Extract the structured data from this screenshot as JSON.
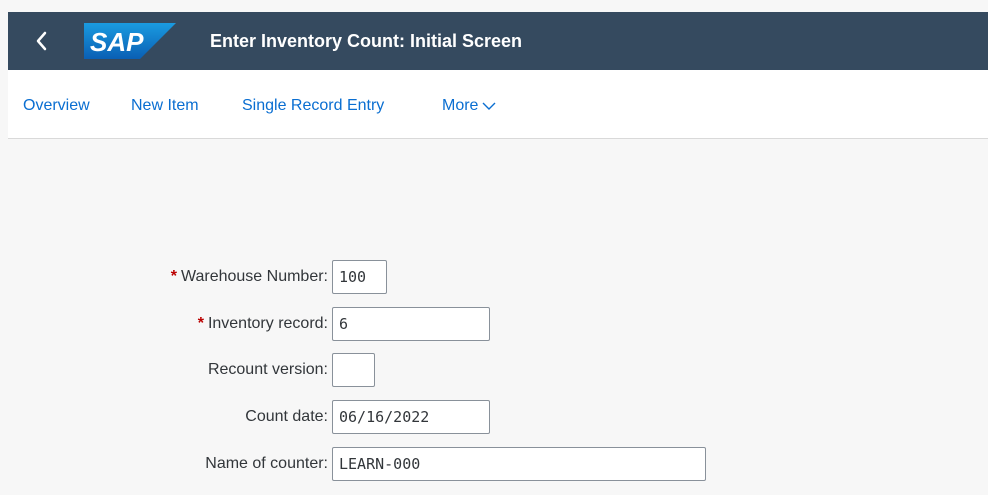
{
  "header": {
    "title": "Enter Inventory Count: Initial Screen",
    "logo_text": "SAP",
    "back_icon": "chevron-left-icon"
  },
  "colors": {
    "shell": "#354a5f",
    "link": "#0a6ed1",
    "required": "#bb0000",
    "logo_blue": "#0f86cf"
  },
  "toolbar": {
    "overview": "Overview",
    "new_item": "New Item",
    "single_record_entry": "Single Record Entry",
    "more": "More",
    "more_icon": "chevron-down-icon"
  },
  "form": {
    "warehouse_number": {
      "label": "Warehouse Number:",
      "value": "100",
      "required": "*"
    },
    "inventory_record": {
      "label": "Inventory record:",
      "value": "6",
      "required": "*"
    },
    "recount_version": {
      "label": "Recount version:",
      "value": ""
    },
    "count_date": {
      "label": "Count date:",
      "value": "06/16/2022"
    },
    "name_of_counter": {
      "label": "Name of counter:",
      "value": "LEARN-000"
    }
  }
}
